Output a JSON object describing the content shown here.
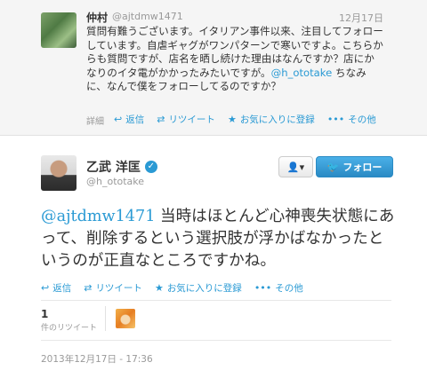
{
  "reply": {
    "name": "仲村",
    "handle": "@ajtdmw1471",
    "date": "12月17日",
    "text_before": "質問有難うございます。イタリアン事件以来、注目してフォローしています。自虐ギャグがワンパターンで寒いですよ。こちらからも質問ですが、店名を晒し続けた理由はなんですか？店にかなりのイタ電がかかったみたいですが。",
    "mention": "@h_ototake",
    "text_after": " ちなみに、なんで僕をフォローしてるのですか？",
    "detail_label": "詳細",
    "actions": [
      "返信",
      "リツイート",
      "お気に入りに登録",
      "その他"
    ]
  },
  "tweet": {
    "name": "乙武 洋匡",
    "handle": "@h_ototake",
    "mention": "@ajtdmw1471",
    "text": " 当時はほとんど心神喪失状態にあって、削除するという選択肢が浮かばなかったというのが正直なところですかね。",
    "follow_label": "フォロー",
    "user_menu_label": "▾",
    "actions": [
      "返信",
      "リツイート",
      "お気に入りに登録",
      "その他"
    ],
    "retweet_count": "1",
    "retweet_label": "件のリツイート",
    "timestamp": "2013年12月17日 - 17:36"
  },
  "colors": {
    "accent": "#2a9ad4",
    "muted": "#999999",
    "text": "#333333"
  }
}
